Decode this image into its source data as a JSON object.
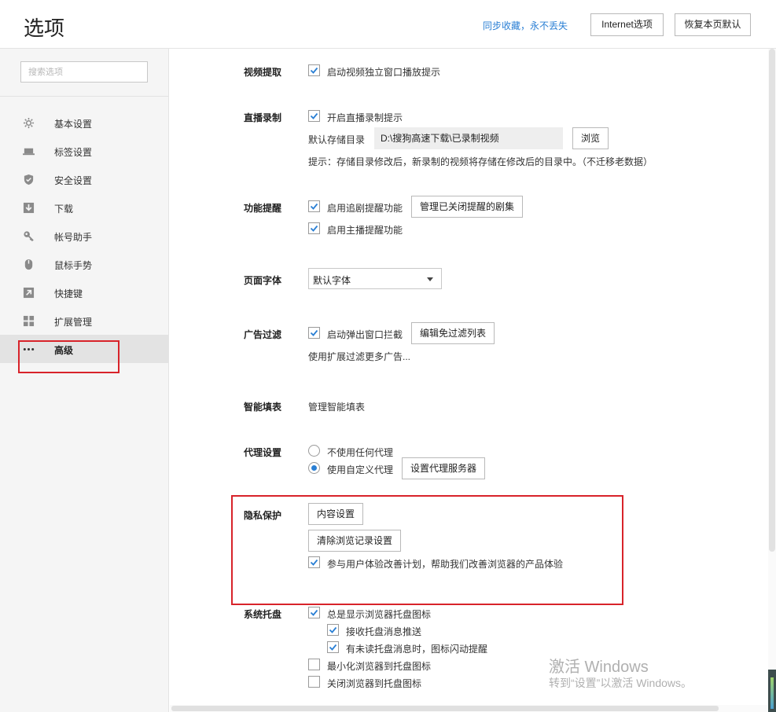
{
  "header": {
    "title": "选项",
    "sync_link": "同步收藏，永不丢失",
    "internet_options": "Internet选项",
    "restore_defaults": "恢复本页默认"
  },
  "sidebar": {
    "search_placeholder": "搜索选项",
    "items": [
      {
        "label": "基本设置",
        "icon": "gear-icon"
      },
      {
        "label": "标签设置",
        "icon": "tab-icon"
      },
      {
        "label": "安全设置",
        "icon": "shield-icon"
      },
      {
        "label": "下载",
        "icon": "download-icon"
      },
      {
        "label": "帐号助手",
        "icon": "key-icon"
      },
      {
        "label": "鼠标手势",
        "icon": "mouse-icon"
      },
      {
        "label": "快捷键",
        "icon": "shortcut-arrow-icon"
      },
      {
        "label": "扩展管理",
        "icon": "extensions-grid-icon"
      },
      {
        "label": "高级",
        "icon": "more-dots-icon",
        "active": true
      }
    ]
  },
  "sections": {
    "video": {
      "label": "视频提取",
      "popout_hint": "启动视频独立窗口播放提示",
      "popout_checked": true
    },
    "live": {
      "label": "直播录制",
      "record_hint": "开启直播录制提示",
      "record_checked": true,
      "dir_label": "默认存储目录",
      "dir_value": "D:\\搜狗高速下载\\已录制视频",
      "browse": "浏览",
      "tip": "提示：存储目录修改后，新录制的视频将存储在修改后的目录中。（不迁移老数据）"
    },
    "reminder": {
      "label": "功能提醒",
      "drama": "启用追剧提醒功能",
      "drama_checked": true,
      "manage": "管理已关闭提醒的剧集",
      "streamer": "启用主播提醒功能",
      "streamer_checked": true
    },
    "font": {
      "label": "页面字体",
      "selected": "默认字体"
    },
    "adblock": {
      "label": "广告过滤",
      "popup_block": "启动弹出窗口拦截",
      "popup_checked": true,
      "edit_list": "编辑免过滤列表",
      "more": "使用扩展过滤更多广告..."
    },
    "autofill": {
      "label": "智能填表",
      "manage": "管理智能填表"
    },
    "proxy": {
      "label": "代理设置",
      "none": "不使用任何代理",
      "custom": "使用自定义代理",
      "selected": "custom",
      "set_server": "设置代理服务器"
    },
    "privacy": {
      "label": "隐私保护",
      "content_settings": "内容设置",
      "clear_history": "清除浏览记录设置",
      "ux_plan": "参与用户体验改善计划，帮助我们改善浏览器的产品体验",
      "ux_checked": true
    },
    "tray": {
      "label": "系统托盘",
      "show_icon": "总是显示浏览器托盘图标",
      "show_checked": true,
      "receive_push": "接收托盘消息推送",
      "receive_checked": true,
      "flash_unread": "有未读托盘消息时，图标闪动提醒",
      "flash_checked": true,
      "minimize_to_tray": "最小化浏览器到托盘图标",
      "minimize_checked": false,
      "close_to_tray": "关闭浏览器到托盘图标",
      "close_checked": false
    }
  },
  "watermark": {
    "title": "激活 Windows",
    "subtitle": "转到“设置”以激活 Windows。"
  },
  "colors": {
    "link": "#2a7fd4",
    "highlight_box": "#d8232a",
    "checkbox_check": "#2a7fd4"
  }
}
